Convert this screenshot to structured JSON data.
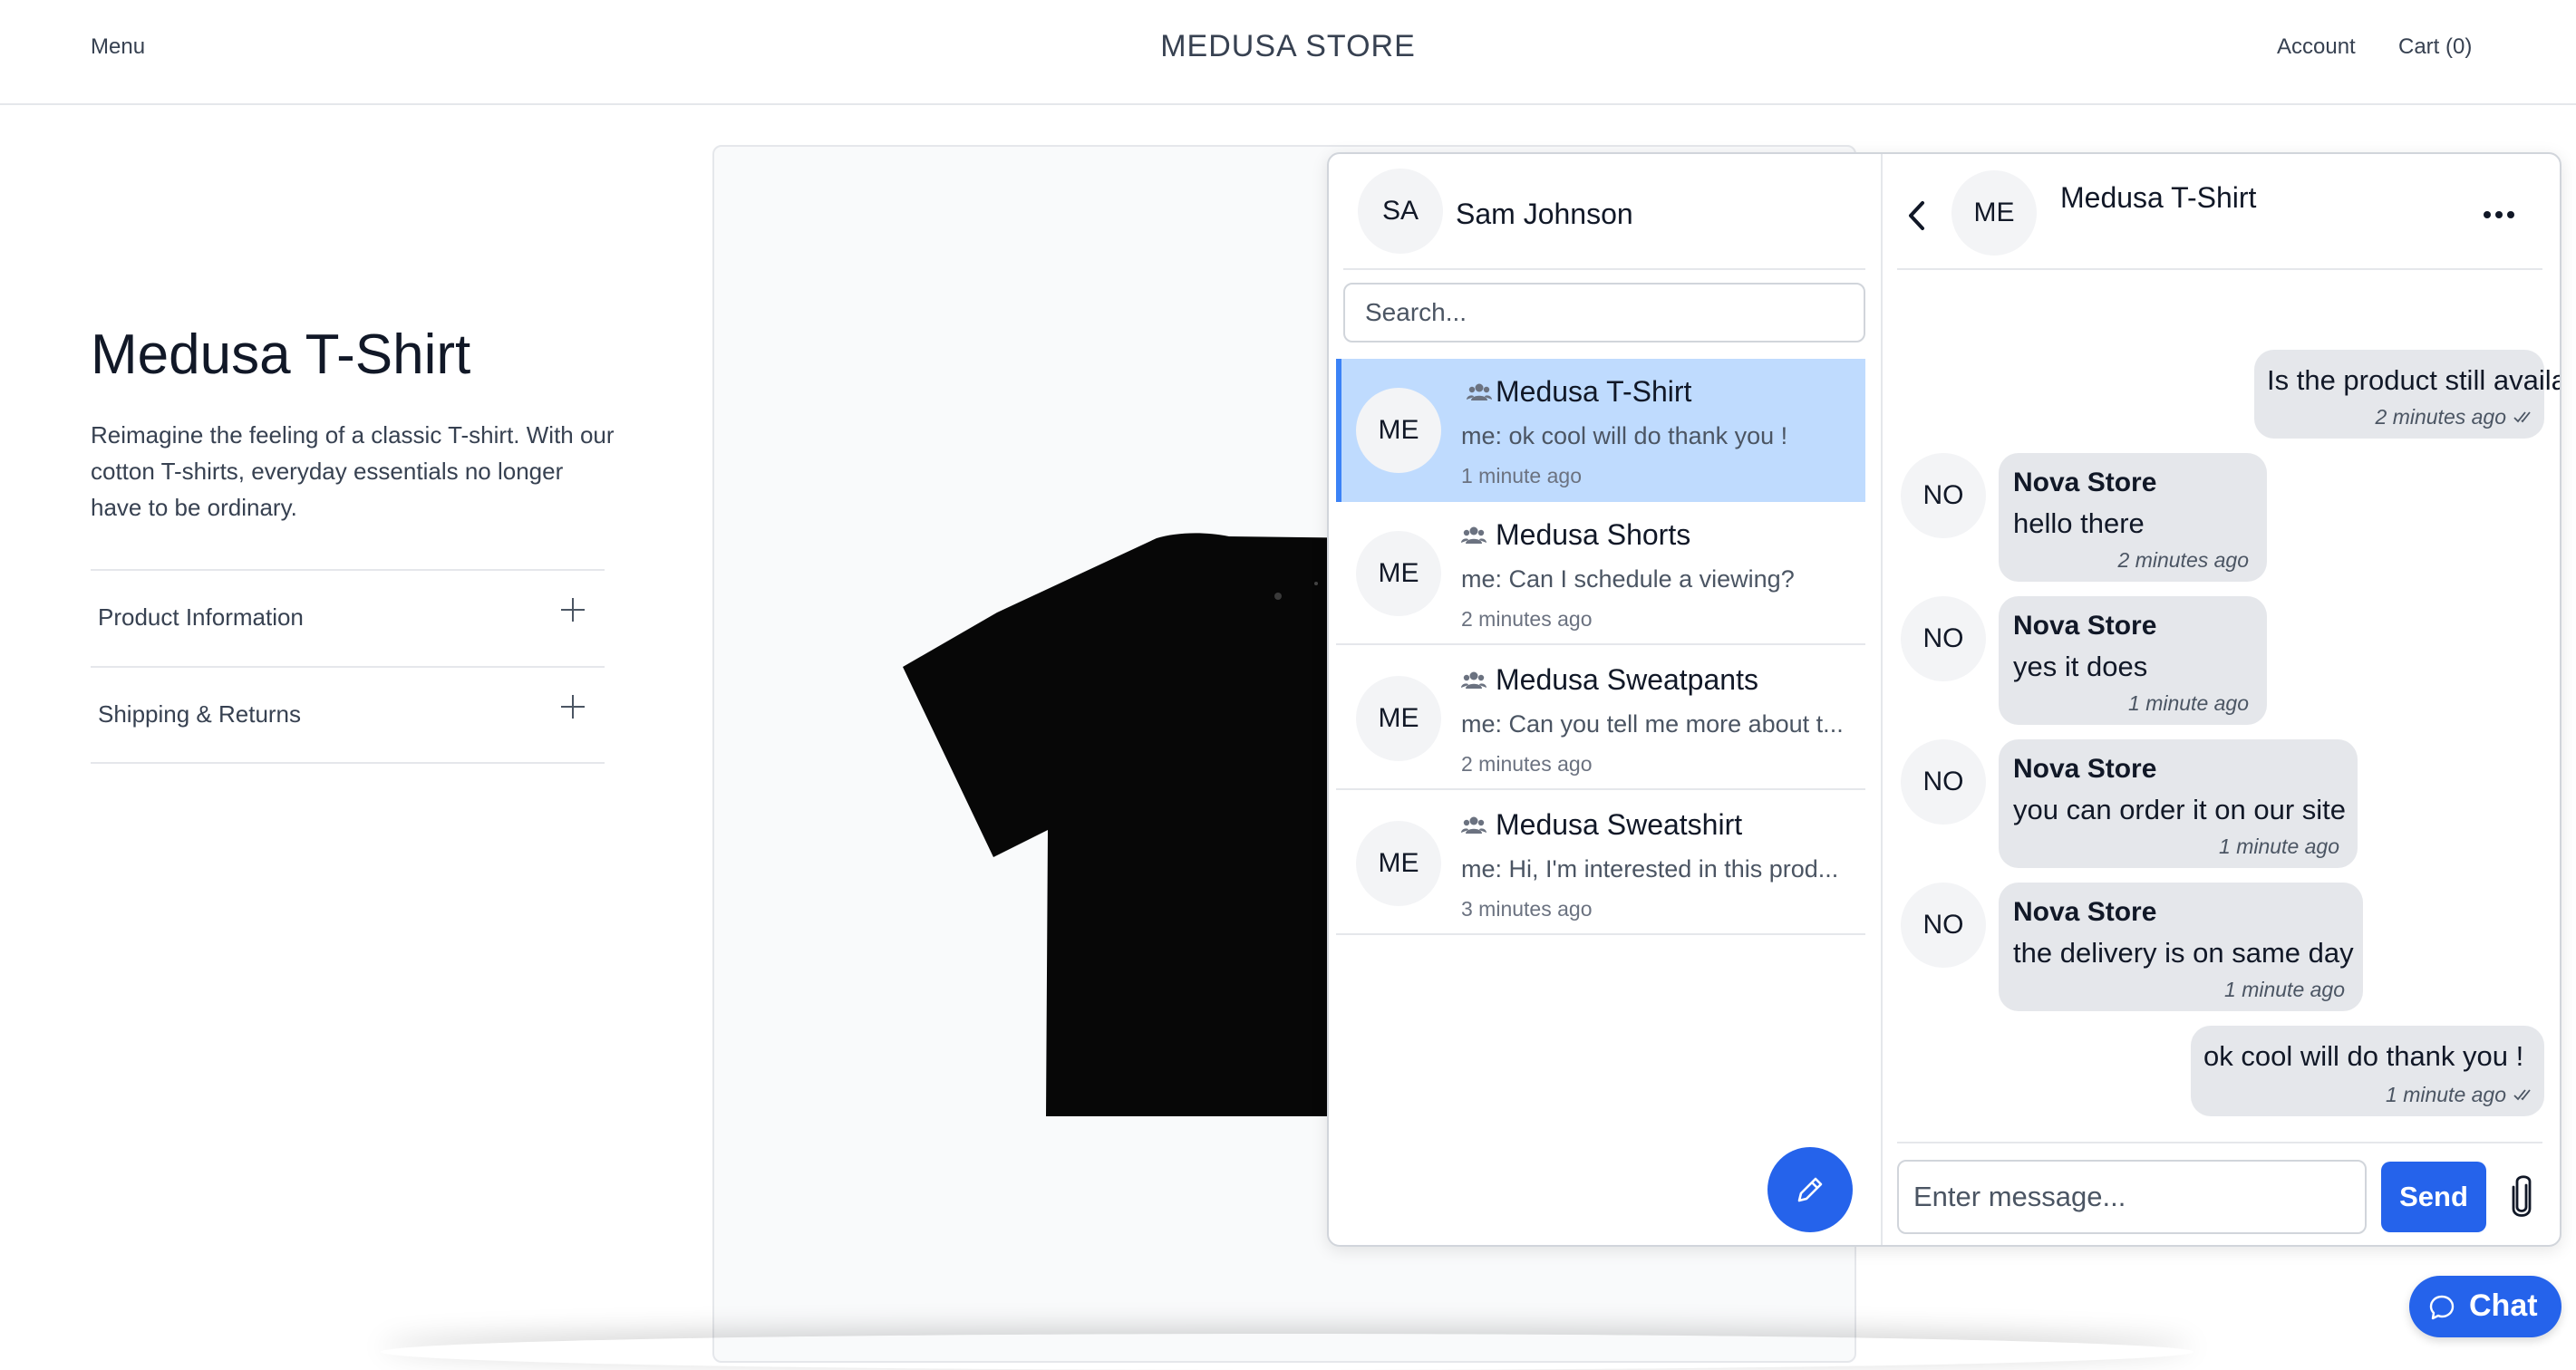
{
  "header": {
    "menu_label": "Menu",
    "store_title": "MEDUSA STORE",
    "account_label": "Account",
    "cart_label": "Cart (0)"
  },
  "product": {
    "title": "Medusa T-Shirt",
    "description": "Reimagine the feeling of a classic T-shirt. With our cotton T-shirts, everyday essentials no longer have to be ordinary.",
    "accordions": [
      {
        "label": "Product Information"
      },
      {
        "label": "Shipping & Returns"
      }
    ]
  },
  "chat": {
    "user": {
      "initials": "SA",
      "name": "Sam Johnson"
    },
    "search_placeholder": "Search...",
    "conversations": [
      {
        "initials": "ME",
        "title": "Medusa T-Shirt",
        "preview": "me: ok cool will do thank you !",
        "time": "1 minute ago",
        "active": true
      },
      {
        "initials": "ME",
        "title": "Medusa Shorts",
        "preview": "me: Can I schedule a viewing?",
        "time": "2 minutes ago",
        "active": false
      },
      {
        "initials": "ME",
        "title": "Medusa Sweatpants",
        "preview": "me: Can you tell me more about t...",
        "time": "2 minutes ago",
        "active": false
      },
      {
        "initials": "ME",
        "title": "Medusa Sweatshirt",
        "preview": "me: Hi, I'm interested in this prod...",
        "time": "3 minutes ago",
        "active": false
      }
    ],
    "thread": {
      "initials": "ME",
      "title": "Medusa T-Shirt",
      "messages": [
        {
          "from": "me",
          "text": "Is the product still available?",
          "time": "2 minutes ago"
        },
        {
          "from": "Nova Store",
          "initials": "NO",
          "text": "hello there",
          "time": "2 minutes ago"
        },
        {
          "from": "Nova Store",
          "initials": "NO",
          "text": "yes it does",
          "time": "1 minute ago"
        },
        {
          "from": "Nova Store",
          "initials": "NO",
          "text": "you can order it on our site",
          "time": "1 minute ago"
        },
        {
          "from": "Nova Store",
          "initials": "NO",
          "text": "the delivery is on same day",
          "time": "1 minute ago"
        },
        {
          "from": "me",
          "text": "ok cool will do thank you !",
          "time": "1 minute ago"
        }
      ]
    },
    "message_placeholder": "Enter message...",
    "send_label": "Send",
    "fab_label": "Chat"
  },
  "colors": {
    "accent": "#2563eb",
    "active_conversation": "#bfdbfe",
    "bubble": "#e5e7eb"
  }
}
